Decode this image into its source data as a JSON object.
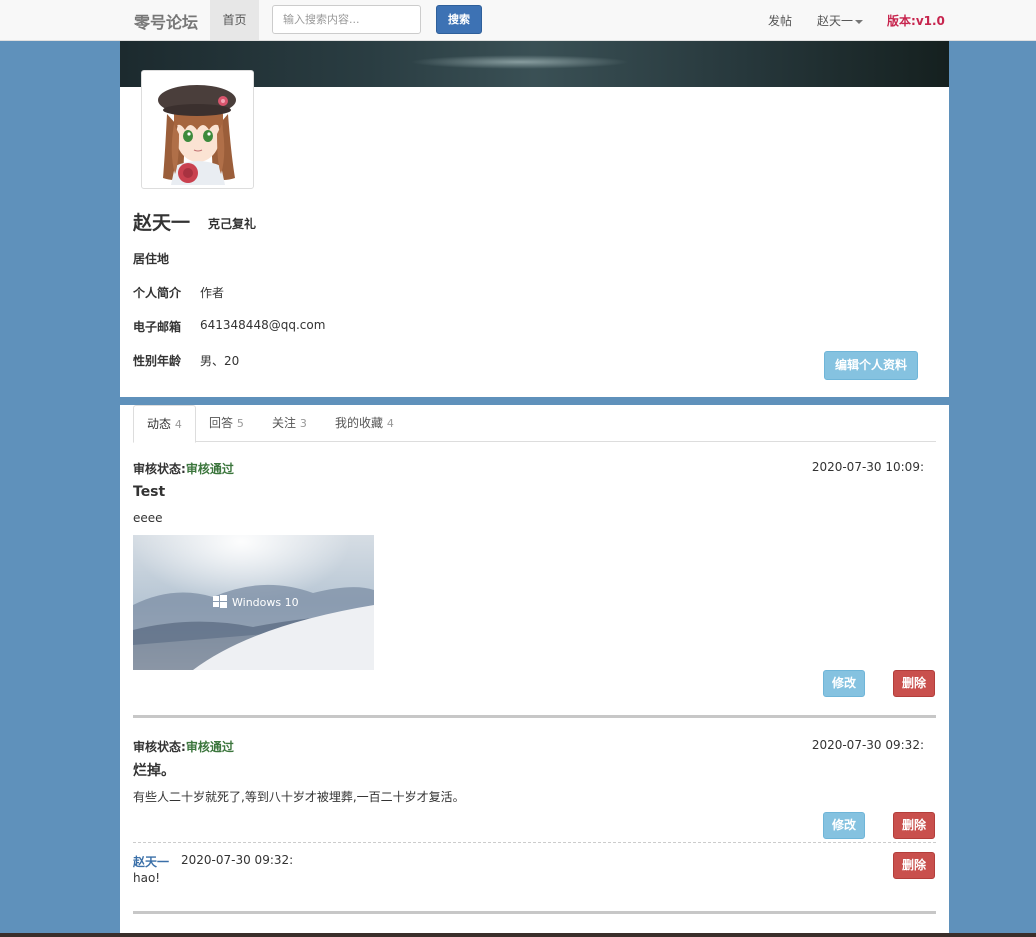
{
  "navbar": {
    "brand": "零号论坛",
    "home": "首页",
    "search_placeholder": "输入搜索内容...",
    "search_button": "搜索",
    "post_link": "发帖",
    "user_menu": "赵天一",
    "version_label": "版本",
    "version_value": ":v1.0"
  },
  "profile": {
    "name": "赵天一",
    "motto": "克己复礼",
    "fields": [
      {
        "label": "居住地",
        "value": ""
      },
      {
        "label": "个人简介",
        "value": "作者"
      },
      {
        "label": "电子邮箱",
        "value": "641348448@qq.com"
      },
      {
        "label": "性别年龄",
        "value": "男、20"
      }
    ],
    "edit_button": "编辑个人资料"
  },
  "tabs": [
    {
      "label": "动态",
      "count": "4",
      "active": true
    },
    {
      "label": "回答",
      "count": "5",
      "active": false
    },
    {
      "label": "关注",
      "count": "3",
      "active": false
    },
    {
      "label": "我的收藏",
      "count": "4",
      "active": false
    }
  ],
  "posts": [
    {
      "status_label": "审核状态:",
      "status_value": "审核通过",
      "time": "2020-07-30 10:09:",
      "title": "Test",
      "body": "eeee",
      "image_caption": "Windows 10",
      "edit_button": "修改",
      "delete_button": "删除"
    },
    {
      "status_label": "审核状态:",
      "status_value": "审核通过",
      "time": "2020-07-30 09:32:",
      "title": "烂掉。",
      "body": "有些人二十岁就死了,等到八十岁才被埋葬,一百二十岁才复活。",
      "edit_button": "修改",
      "delete_button": "删除",
      "reply": {
        "author": "赵天一",
        "time": "2020-07-30 09:32:",
        "text": "hao!",
        "delete_button": "删除"
      }
    }
  ]
}
